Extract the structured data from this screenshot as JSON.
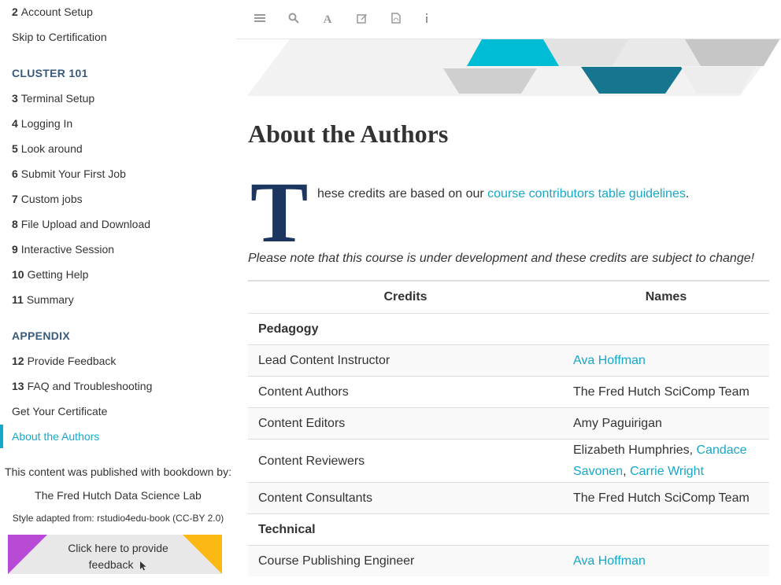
{
  "sidebar": {
    "items_top": [
      {
        "num": "2",
        "label": "Account Setup"
      },
      {
        "num": "",
        "label": "Skip to Certification"
      }
    ],
    "section_cluster": "CLUSTER 101",
    "items_cluster": [
      {
        "num": "3",
        "label": "Terminal Setup"
      },
      {
        "num": "4",
        "label": "Logging In"
      },
      {
        "num": "5",
        "label": "Look around"
      },
      {
        "num": "6",
        "label": "Submit Your First Job"
      },
      {
        "num": "7",
        "label": "Custom jobs"
      },
      {
        "num": "8",
        "label": "File Upload and Download"
      },
      {
        "num": "9",
        "label": "Interactive Session"
      },
      {
        "num": "10",
        "label": "Getting Help"
      },
      {
        "num": "11",
        "label": "Summary"
      }
    ],
    "section_appendix": "APPENDIX",
    "items_appendix": [
      {
        "num": "12",
        "label": "Provide Feedback"
      },
      {
        "num": "13",
        "label": "FAQ and Troubleshooting"
      },
      {
        "num": "",
        "label": "Get Your Certificate"
      },
      {
        "num": "",
        "label": "About the Authors"
      }
    ],
    "published_by": "This content was published with bookdown by:",
    "publisher": "The Fred Hutch Data Science Lab",
    "style_note": "Style adapted from: rstudio4edu-book (CC-BY 2.0)",
    "feedback_label": "Click here to provide feedback",
    "colors": {
      "accent": "#16a8c8",
      "purple": "#b84ad6",
      "yellow": "#fdb913"
    }
  },
  "toolbar": {
    "icons": [
      "menu-icon",
      "search-icon",
      "font-icon",
      "edit-icon",
      "pdf-icon",
      "info-icon"
    ]
  },
  "main": {
    "title": "About the Authors",
    "dropcap": "T",
    "intro_text": "hese credits are based on our ",
    "intro_link": "course contributors table guidelines",
    "intro_end": ".",
    "note": "Please note that this course is under development and these credits are subject to change!",
    "table": {
      "headers": [
        "Credits",
        "Names"
      ],
      "rows": [
        {
          "type": "section",
          "credit": "Pedagogy",
          "names": []
        },
        {
          "credit": "Lead Content Instructor",
          "names": [
            {
              "text": "Ava Hoffman",
              "link": true
            }
          ]
        },
        {
          "credit": "Content Authors",
          "names": [
            {
              "text": "The Fred Hutch SciComp Team",
              "link": false
            }
          ]
        },
        {
          "credit": "Content Editors",
          "names": [
            {
              "text": "Amy Paguirigan",
              "link": false
            }
          ]
        },
        {
          "credit": "Content Reviewers",
          "names": [
            {
              "text": "Elizabeth Humphries, ",
              "link": false
            },
            {
              "text": "Candace Savonen",
              "link": true
            },
            {
              "text": ", ",
              "link": false
            },
            {
              "text": "Carrie Wright",
              "link": true
            }
          ]
        },
        {
          "credit": "Content Consultants",
          "names": [
            {
              "text": "The Fred Hutch SciComp Team",
              "link": false
            }
          ]
        },
        {
          "type": "section",
          "credit": "Technical",
          "names": []
        },
        {
          "credit": "Course Publishing Engineer",
          "names": [
            {
              "text": "Ava Hoffman",
              "link": true
            }
          ]
        }
      ]
    }
  }
}
